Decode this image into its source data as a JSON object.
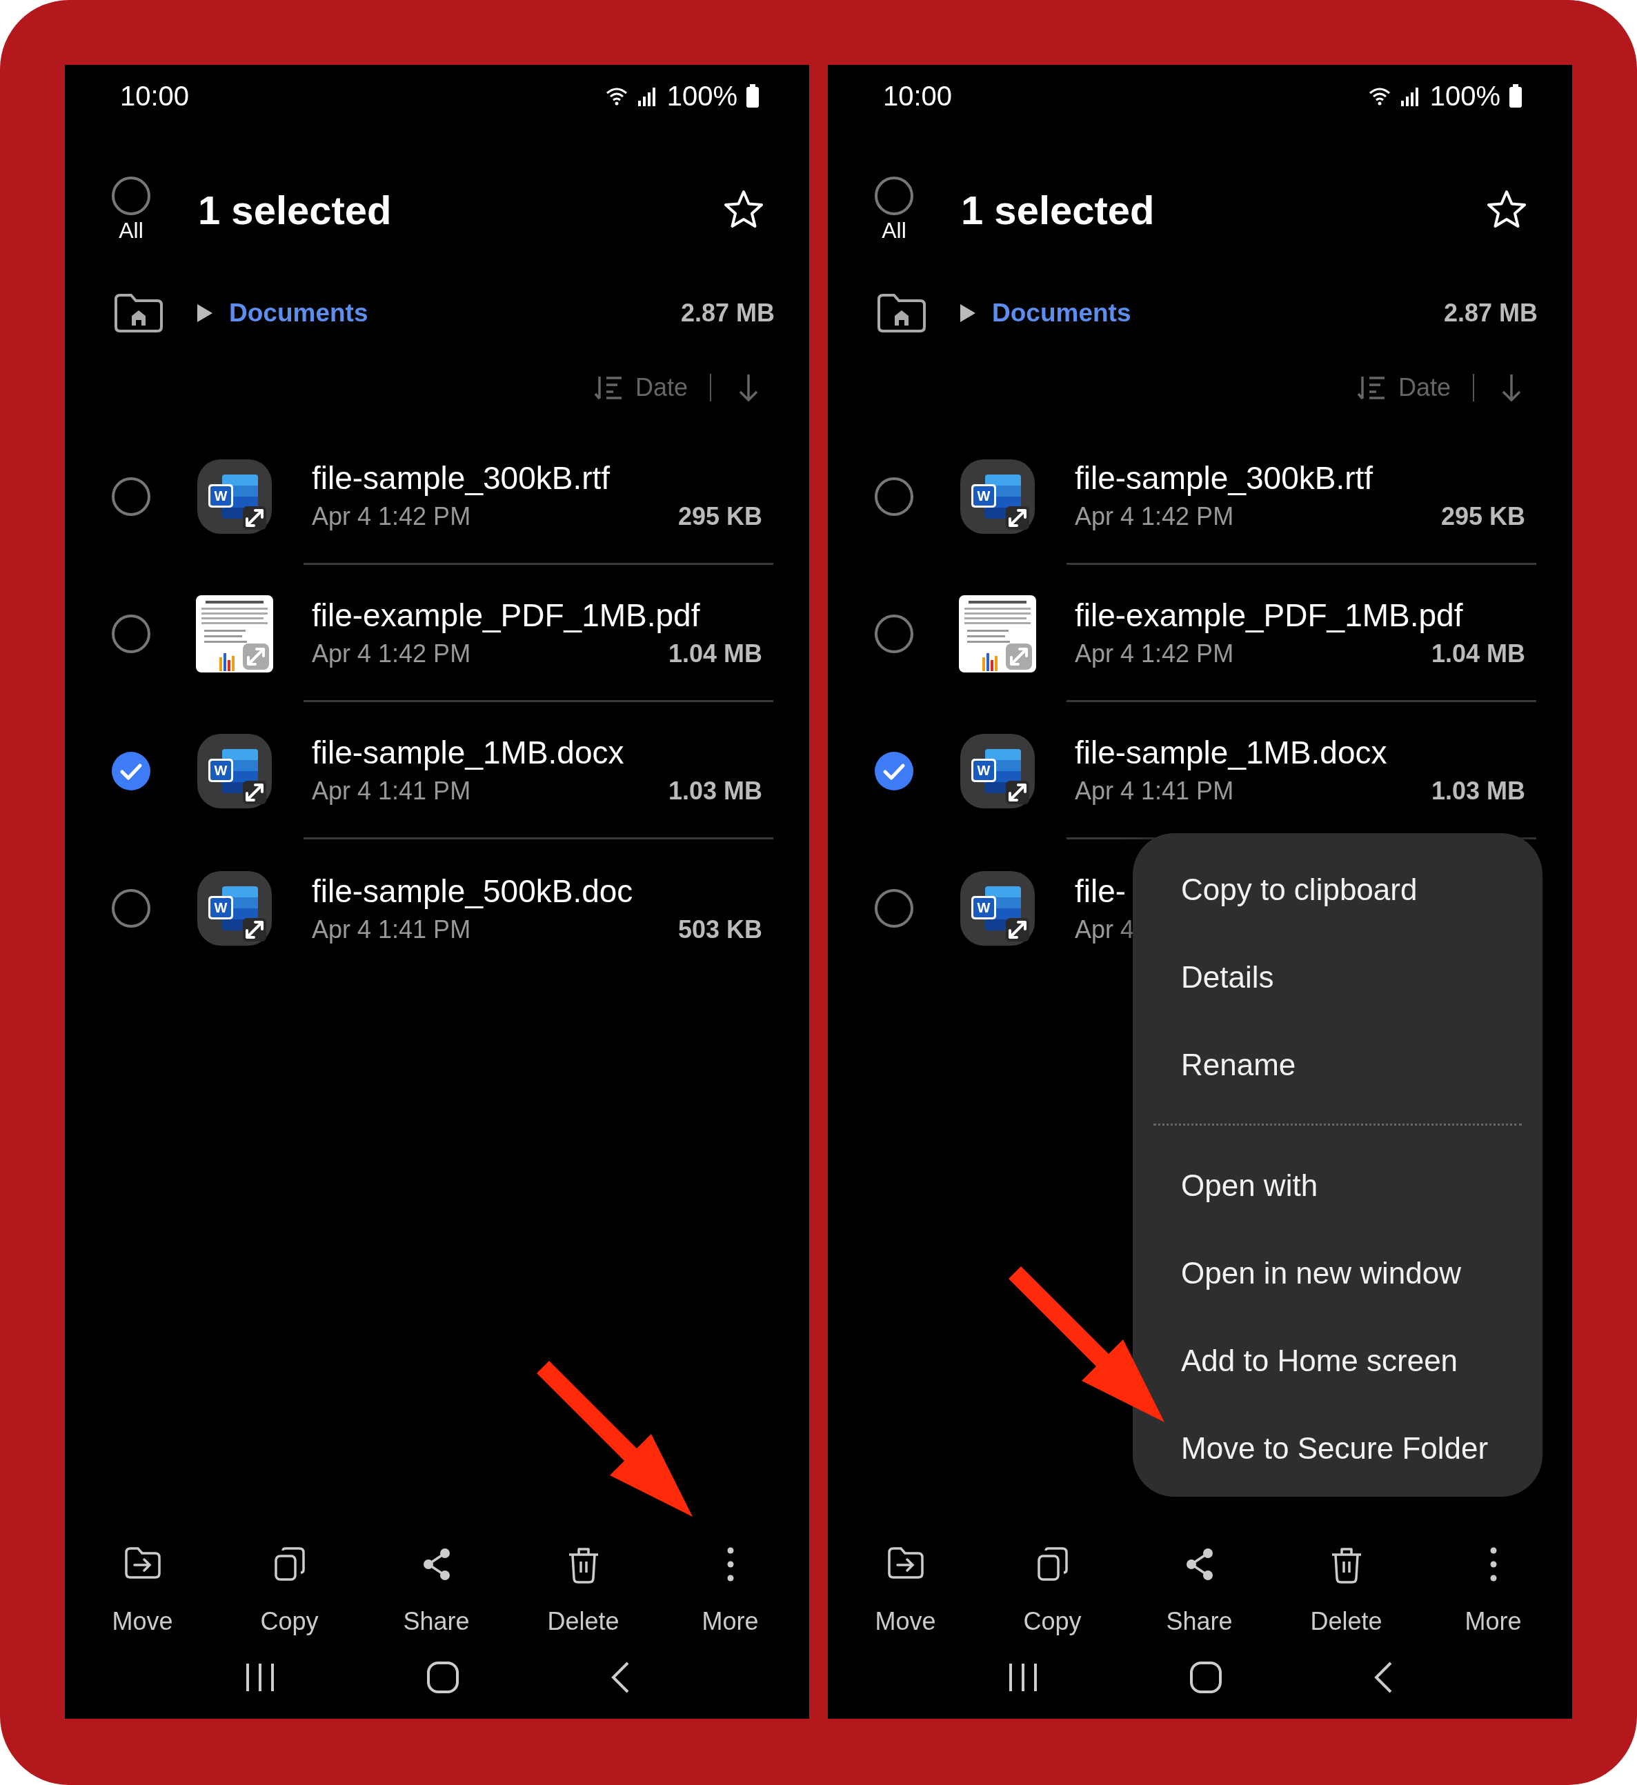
{
  "screens": [
    {
      "status_bar": {
        "time": "10:00",
        "battery": "100%"
      },
      "header": {
        "select_all": {
          "label": "All",
          "checked": false
        },
        "title": "1 selected",
        "starred": false
      },
      "breadcrumb": {
        "folder": "Documents",
        "size": "2.87 MB"
      },
      "sort": {
        "label": "Date"
      },
      "files": [
        {
          "kind": "word",
          "icon_letter": "W",
          "name": "file-sample_300kB.rtf",
          "date": "Apr 4 1:42 PM",
          "size": "295 KB",
          "selected": false
        },
        {
          "kind": "pdf",
          "name": "file-example_PDF_1MB.pdf",
          "date": "Apr 4 1:42 PM",
          "size": "1.04 MB",
          "selected": false
        },
        {
          "kind": "word",
          "icon_letter": "W",
          "name": "file-sample_1MB.docx",
          "date": "Apr 4 1:41 PM",
          "size": "1.03 MB",
          "selected": true
        },
        {
          "kind": "word",
          "icon_letter": "W",
          "name": "file-sample_500kB.doc",
          "date": "Apr 4 1:41 PM",
          "size": "503 KB",
          "selected": false
        }
      ],
      "toolbar": [
        {
          "kind": "move",
          "label": "Move"
        },
        {
          "kind": "copy",
          "label": "Copy"
        },
        {
          "kind": "share",
          "label": "Share"
        },
        {
          "kind": "delete",
          "label": "Delete"
        },
        {
          "kind": "more",
          "label": "More"
        }
      ]
    },
    {
      "status_bar": {
        "time": "10:00",
        "battery": "100%"
      },
      "header": {
        "select_all": {
          "label": "All",
          "checked": false
        },
        "title": "1 selected",
        "starred": false
      },
      "breadcrumb": {
        "folder": "Documents",
        "size": "2.87 MB"
      },
      "sort": {
        "label": "Date"
      },
      "files": [
        {
          "kind": "word",
          "icon_letter": "W",
          "name": "file-sample_300kB.rtf",
          "date": "Apr 4 1:42 PM",
          "size": "295 KB",
          "selected": false
        },
        {
          "kind": "pdf",
          "name": "file-example_PDF_1MB.pdf",
          "date": "Apr 4 1:42 PM",
          "size": "1.04 MB",
          "selected": false
        },
        {
          "kind": "word",
          "icon_letter": "W",
          "name": "file-sample_1MB.docx",
          "date": "Apr 4 1:41 PM",
          "size": "1.03 MB",
          "selected": true
        },
        {
          "kind": "word",
          "icon_letter": "W",
          "name": "file-",
          "date": "Apr 4",
          "selected": false
        }
      ],
      "menu": {
        "groups": [
          [
            "Copy to clipboard",
            "Details",
            "Rename"
          ],
          [
            "Open with",
            "Open in new window",
            "Add to Home screen",
            "Move to Secure Folder"
          ]
        ]
      },
      "toolbar": [
        {
          "kind": "move",
          "label": "Move"
        },
        {
          "kind": "copy",
          "label": "Copy"
        },
        {
          "kind": "share",
          "label": "Share"
        },
        {
          "kind": "delete",
          "label": "Delete"
        },
        {
          "kind": "more",
          "label": "More"
        }
      ]
    }
  ]
}
